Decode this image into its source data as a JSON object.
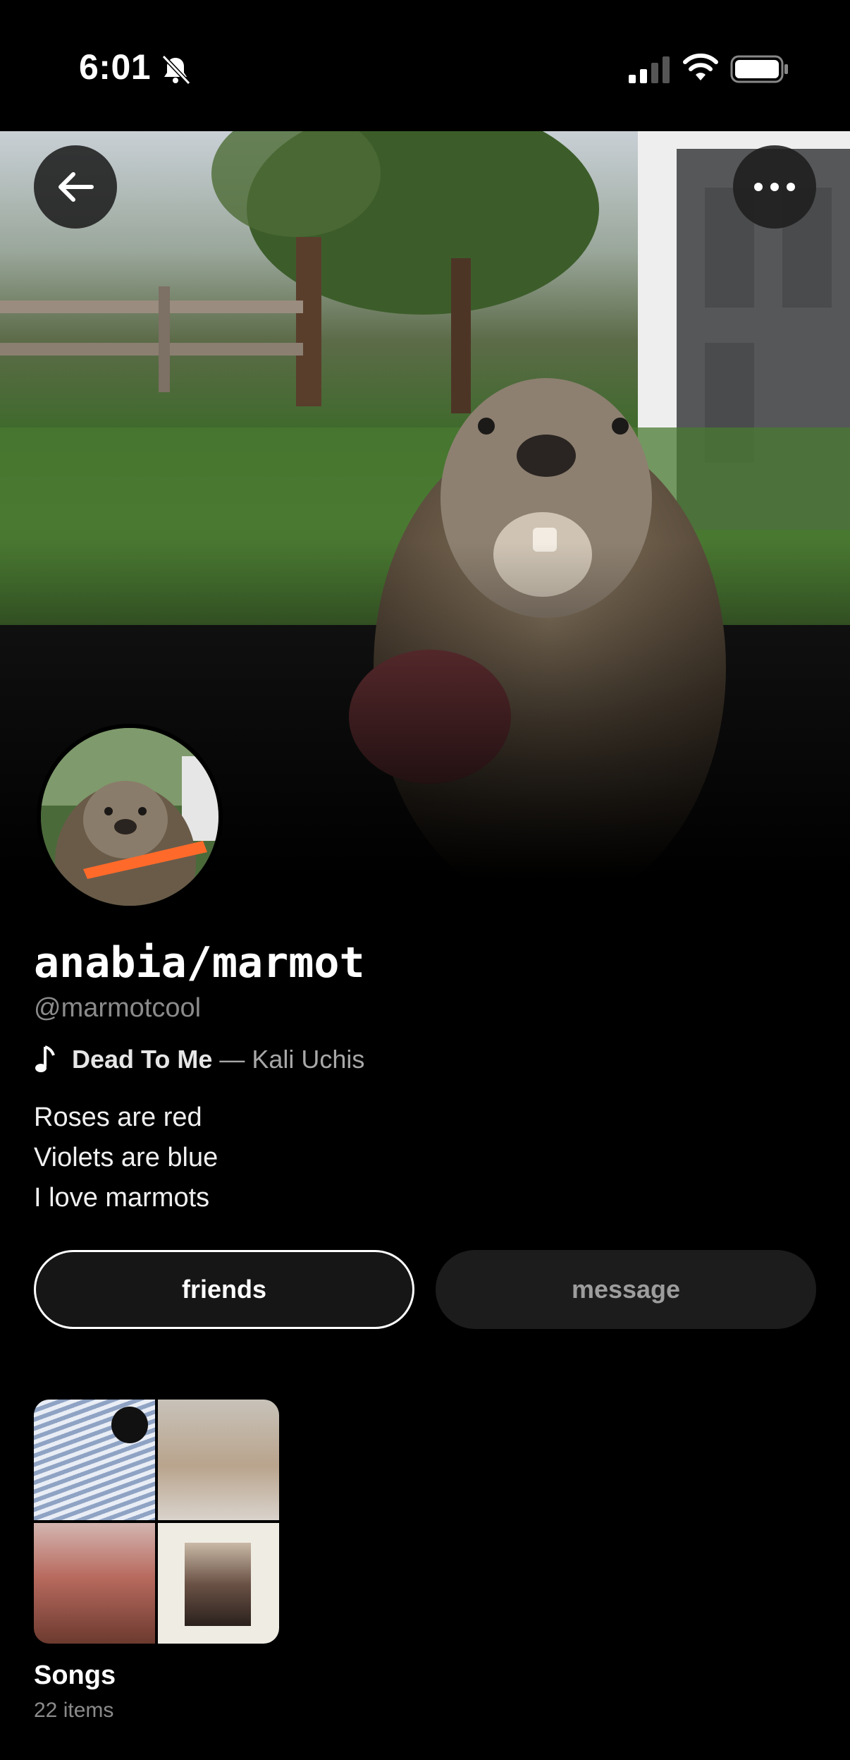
{
  "status_bar": {
    "time": "6:01",
    "icons": [
      "bell-slash-icon",
      "cellular-signal-icon",
      "wifi-icon",
      "battery-icon"
    ]
  },
  "header": {
    "back_icon": "arrow-left-icon",
    "more_icon": "ellipsis-icon"
  },
  "profile": {
    "display_name": "anabia/marmot",
    "username": "@marmotcool",
    "now_playing": {
      "icon": "music-note-icon",
      "title": "Dead To Me",
      "separator": "—",
      "artist": "Kali Uchis"
    },
    "bio": [
      "Roses are red",
      "Violets are blue",
      "I love marmots"
    ]
  },
  "actions": {
    "friends_label": "friends",
    "message_label": "message"
  },
  "playlist": {
    "title": "Songs",
    "count": "22 items"
  },
  "colors": {
    "background": "#000000",
    "secondary_text": "#8b8b8b",
    "button_fill": "#1c1c1c"
  }
}
